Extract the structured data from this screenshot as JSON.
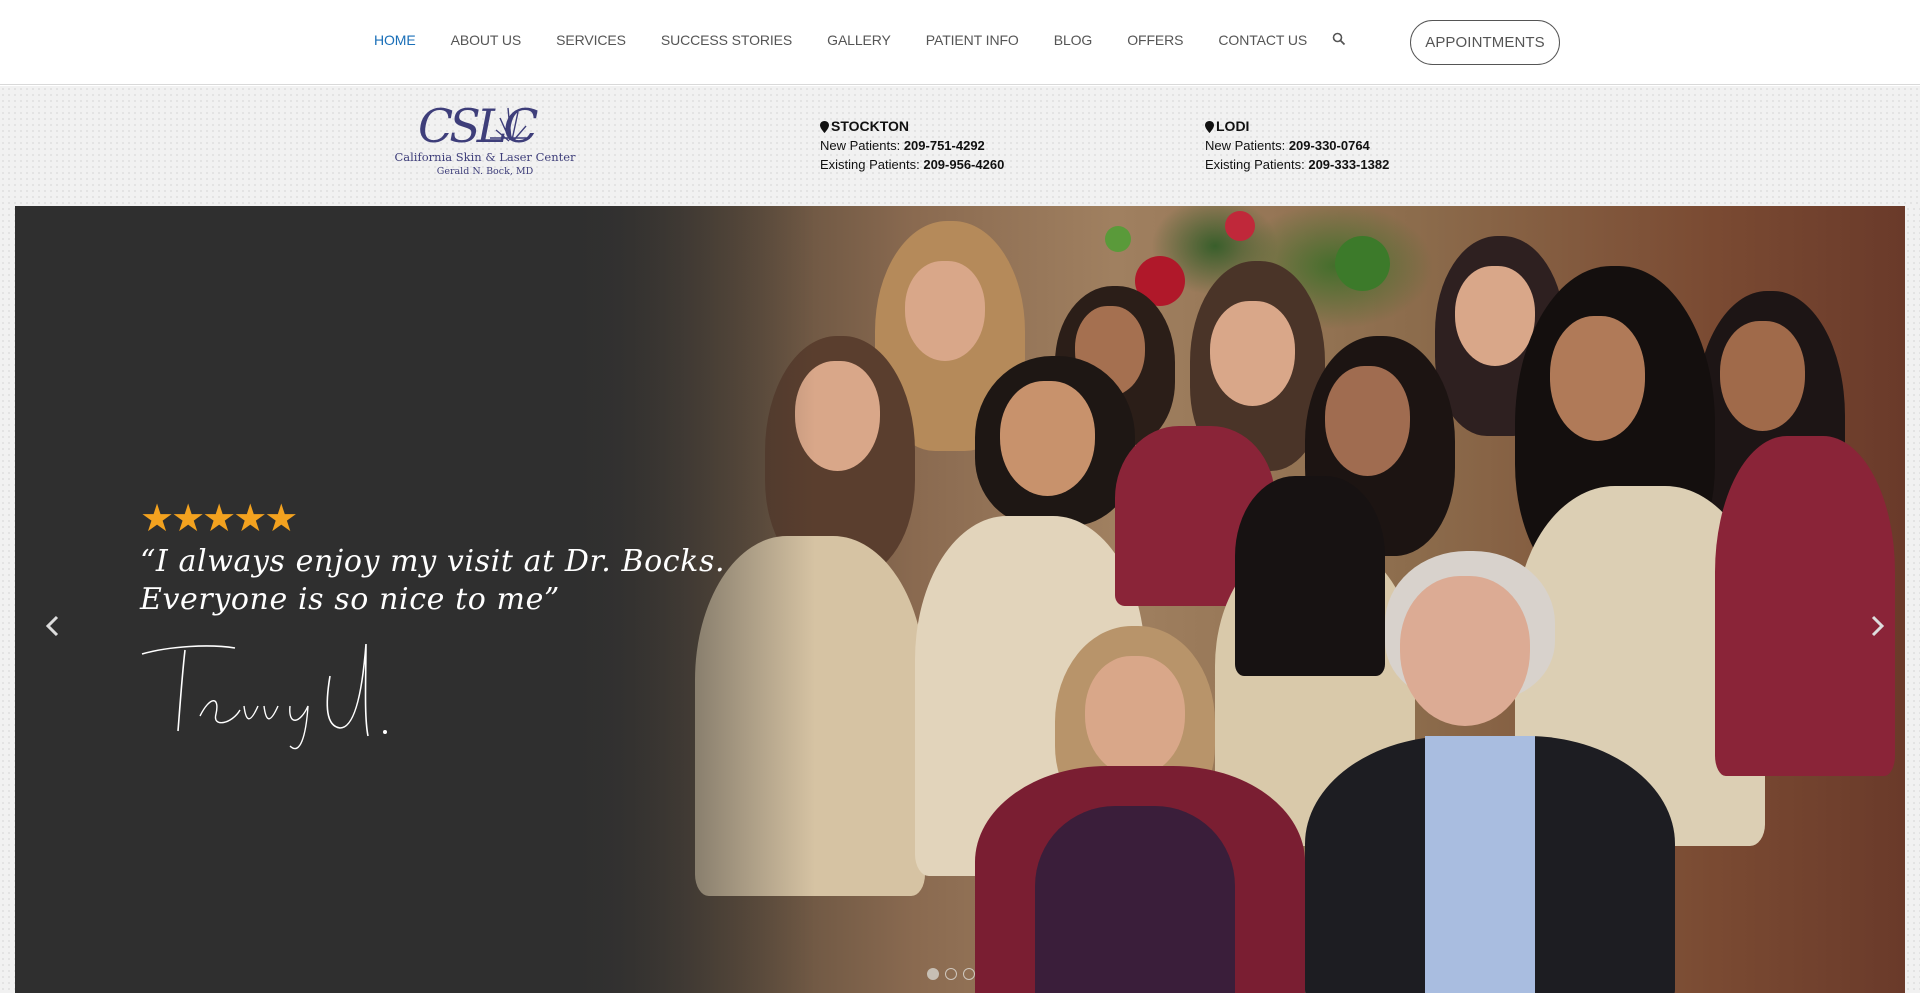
{
  "nav": {
    "items": [
      {
        "label": "HOME",
        "active": true
      },
      {
        "label": "ABOUT US"
      },
      {
        "label": "SERVICES"
      },
      {
        "label": "SUCCESS STORIES"
      },
      {
        "label": "GALLERY"
      },
      {
        "label": "PATIENT INFO"
      },
      {
        "label": "BLOG"
      },
      {
        "label": "OFFERS"
      },
      {
        "label": "CONTACT US"
      }
    ],
    "search_icon": "search-icon",
    "appointments_label": "APPOINTMENTS"
  },
  "logo": {
    "monogram": "CSLC",
    "name": "California Skin & Laser Center",
    "doctor": "Gerald N. Bock, MD"
  },
  "locations": [
    {
      "city": "STOCKTON",
      "new_label": "New Patients:",
      "new_phone": "209-751-4292",
      "existing_label": "Existing Patients:",
      "existing_phone": "209-956-4260"
    },
    {
      "city": "LODI",
      "new_label": "New Patients:",
      "new_phone": "209-330-0764",
      "existing_label": "Existing Patients:",
      "existing_phone": "209-333-1382"
    }
  ],
  "hero": {
    "rating": 5,
    "stars": "★★★★★",
    "quote_line1": "“I always enjoy my visit at Dr. Bocks.",
    "quote_line2": "Everyone is so nice to me”",
    "signature": "Terry U.",
    "slides": 3,
    "active_slide": 1
  },
  "colors": {
    "nav_active": "#1a6fb8",
    "star": "#f3a21f",
    "hero_dark": "#2f2f2f"
  }
}
